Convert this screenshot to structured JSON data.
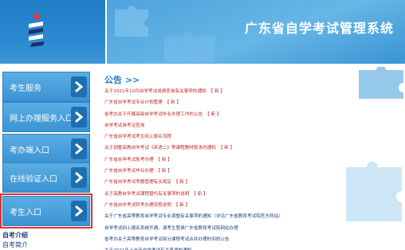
{
  "header": {
    "site_title": "广东省自学考试管理系统"
  },
  "nav": {
    "items": [
      {
        "label": "考生服务"
      },
      {
        "label": "网上办理服务入口"
      },
      {
        "label": "考办端入口"
      },
      {
        "label": "在线验证入口"
      },
      {
        "label": "考生入口"
      }
    ],
    "sub_links": [
      "自考介绍",
      "自考简介"
    ]
  },
  "announcements": {
    "title": "公告 >>",
    "more_label": "【 新 】",
    "items": [
      {
        "text": "关于2021年10月自学考试成绩查询有关事项的通知",
        "color": "red",
        "more": true
      },
      {
        "text": "广东省自学考试专业计划管理",
        "color": "red",
        "more": true
      },
      {
        "text": "省考办关于开展高级自学考试毕业办理工作的公告",
        "color": "red",
        "more": true
      },
      {
        "text": "自学考试准考证查询",
        "color": "red",
        "more": false
      },
      {
        "text": "广东省自学考试考生网上报名流程",
        "color": "red",
        "more": false
      },
      {
        "text": "关于调整高教自学考试《英语二》等课程教材版本的通知",
        "color": "red",
        "more": true
      },
      {
        "text": "广东省自学考试免考办理",
        "color": "red",
        "more": true
      },
      {
        "text": "广东省自学考试毕业办理",
        "color": "red",
        "more": true
      },
      {
        "text": "广东省自学考试考籍管理有关规定",
        "color": "red",
        "more": true
      },
      {
        "text": "关于高教自学考试课程替代有关事项的说明",
        "color": "red",
        "more": true
      },
      {
        "text": "广东省自学考试转考办理流程说明",
        "color": "red",
        "more": true
      },
      {
        "text": "关于广东省高等教育自学考试专业调整有关事项的通知（详见广东省教育考试院官方网站）",
        "color": "blue",
        "more": false
      },
      {
        "text": "自学考试网上报名系统开通，请考生登录广东省教育考试院网站办理",
        "color": "blue",
        "more": false
      },
      {
        "text": "省考办关于高等教育自学考试部分课程考试合并办理时间的公告",
        "color": "blue",
        "more": false
      },
      {
        "text": "关于2021年上半年自学考试有关事项的通知",
        "color": "blue",
        "more": false
      }
    ]
  },
  "colors": {
    "brand_blue": "#1f7bc4",
    "banner_blue": "#4ea3dd",
    "nav_blue": "#3a93d2",
    "link_red": "#c02828",
    "link_blue": "#1a3f7a",
    "highlight": "#e03030"
  },
  "icons": {
    "logo": "exam-logo-icon",
    "nav_arrow": "chevron-right-icon",
    "decoration": "puzzle-icon"
  }
}
